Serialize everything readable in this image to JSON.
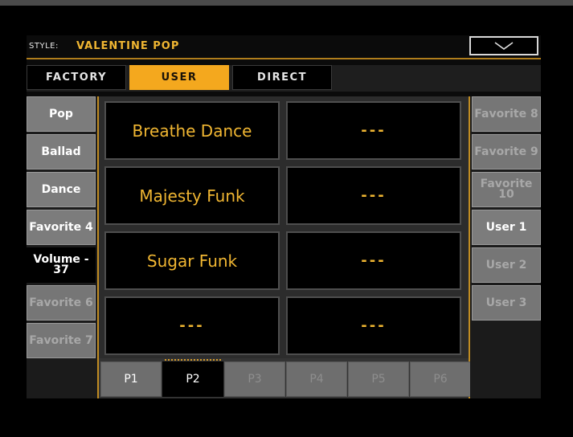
{
  "header": {
    "label": "STYLE:",
    "title": "VALENTINE POP",
    "menu_icon": "chevron-down-icon"
  },
  "tabs": [
    {
      "label": "FACTORY",
      "active": false
    },
    {
      "label": "USER",
      "active": true
    },
    {
      "label": "DIRECT",
      "active": false
    }
  ],
  "left_buttons": [
    {
      "label": "Pop",
      "state": "normal"
    },
    {
      "label": "Ballad",
      "state": "normal"
    },
    {
      "label": "Dance",
      "state": "normal"
    },
    {
      "label": "Favorite 4",
      "state": "normal"
    },
    {
      "label": "Volume - 37",
      "state": "selected"
    },
    {
      "label": "Favorite 6",
      "state": "dim"
    },
    {
      "label": "Favorite 7",
      "state": "dim"
    }
  ],
  "right_buttons": [
    {
      "label": "Favorite 8",
      "state": "dim"
    },
    {
      "label": "Favorite 9",
      "state": "dim"
    },
    {
      "label": "Favorite 10",
      "state": "dim"
    },
    {
      "label": "User 1",
      "state": "normal"
    },
    {
      "label": "User 2",
      "state": "dim"
    },
    {
      "label": "User 3",
      "state": "dim"
    }
  ],
  "grid": [
    {
      "label": "Breathe Dance"
    },
    {
      "label": "---"
    },
    {
      "label": "Majesty Funk"
    },
    {
      "label": "---"
    },
    {
      "label": "Sugar Funk"
    },
    {
      "label": "---"
    },
    {
      "label": "---"
    },
    {
      "label": "---"
    }
  ],
  "pages": [
    {
      "label": "P1",
      "state": "enabled"
    },
    {
      "label": "P2",
      "state": "active"
    },
    {
      "label": "P3",
      "state": "disabled"
    },
    {
      "label": "P4",
      "state": "disabled"
    },
    {
      "label": "P5",
      "state": "disabled"
    },
    {
      "label": "P6",
      "state": "disabled"
    }
  ],
  "colors": {
    "accent": "#f4a81e",
    "text_amber": "#f0b632",
    "button_gray": "#7c7c7c"
  }
}
